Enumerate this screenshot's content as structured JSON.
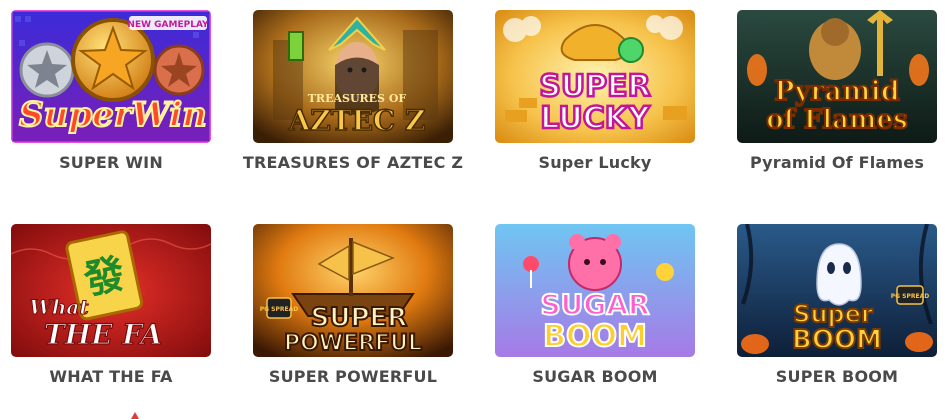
{
  "games": [
    {
      "title": "SUPER WIN",
      "art_text": "SuperWin",
      "badge": "NEW GAMEPLAY"
    },
    {
      "title": "TREASURES OF AZTEC Z",
      "art_small": "TREASURES OF",
      "art_text": "AZTEC Z"
    },
    {
      "title": "Super Lucky",
      "art_text_1": "SUPER",
      "art_text_2": "LUCKY"
    },
    {
      "title": "Pyramid Of Flames",
      "art_text_1": "Pyramid",
      "art_text_2": "of Flames"
    },
    {
      "title": "WHAT THE FA",
      "art_text_1": "What",
      "art_text_2": "THE FA",
      "tile_glyph": "發"
    },
    {
      "title": "SUPER POWERFUL",
      "art_badge": "PG SPREAD",
      "art_text_1": "SUPER",
      "art_text_2": "POWERFUL"
    },
    {
      "title": "SUGAR BOOM",
      "art_text_1": "SUGAR",
      "art_text_2": "BOOM"
    },
    {
      "title": "SUPER BOOM",
      "art_badge": "PG SPREAD",
      "art_text_1": "Super",
      "art_text_2": "BOOM"
    }
  ],
  "colors": {
    "title_text": "#4a4a4a",
    "background": "#ffffff"
  }
}
